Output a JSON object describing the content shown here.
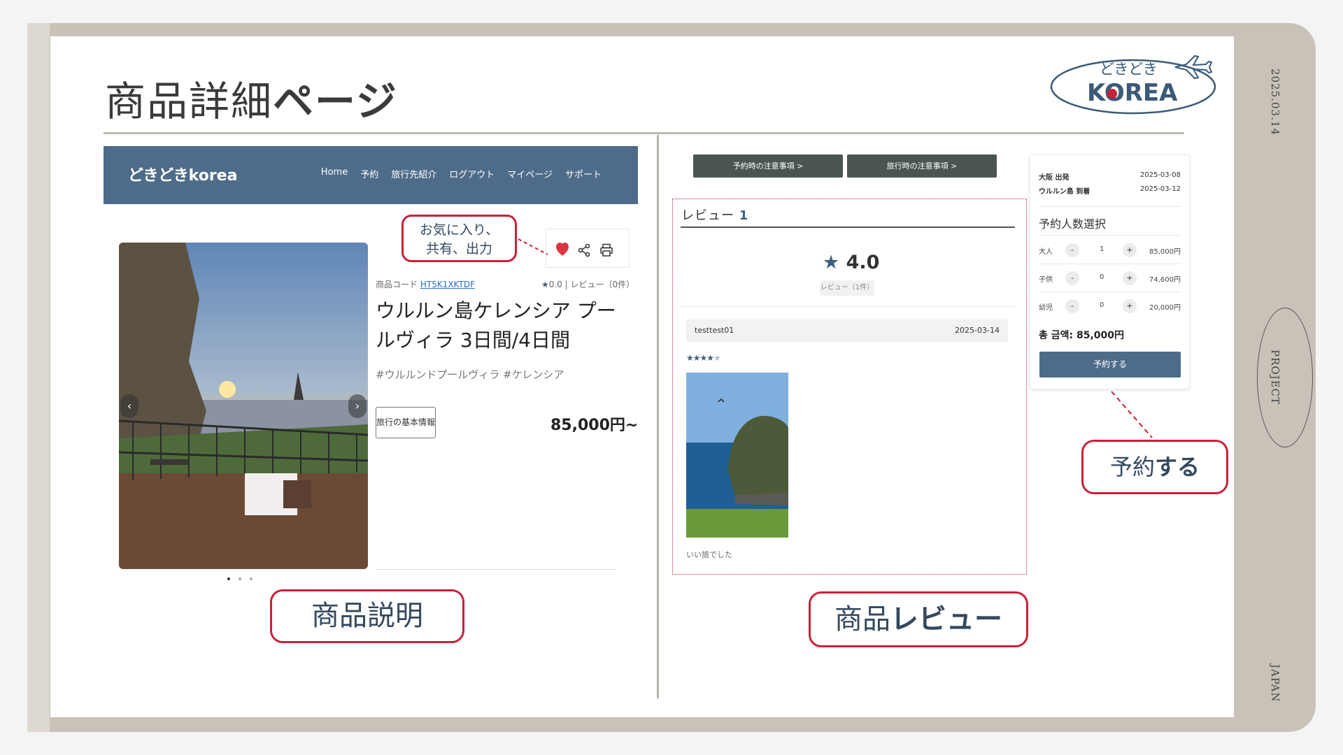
{
  "slide": {
    "title_light": "商品詳細",
    "title_bold": "ページ",
    "date": "2025.03.14",
    "side_project": "PROJECT",
    "side_japan": "JAPAN",
    "logo_top": "どきどき",
    "logo_bottom": "KOREA"
  },
  "site": {
    "brand": "どきどきkorea",
    "nav": [
      "Home",
      "予約",
      "旅行先紹介",
      "ログアウト",
      "マイページ",
      "サポート"
    ]
  },
  "product": {
    "code_label": "商品コード",
    "code": "HT5K1XKTDF",
    "rating_mini": "0.0",
    "review_mini": "レビュー（0件）",
    "name": "ウルルン島ケレンシア プールヴィラ 3日間/4日間",
    "tags": "#ウルルンドプールヴィラ #ケレンシア",
    "info_button": "旅行の基本情報",
    "price": "85,000円~"
  },
  "callouts": {
    "favorite_line1": "お気に入り、",
    "favorite_line2": "共有、出力",
    "product_desc": "商品説明",
    "product_review_light": "商品",
    "product_review_bold": "レビュー",
    "reserve_light": "予約",
    "reserve_bold": "する"
  },
  "notices": [
    "予約時の注意事項 >",
    "旅行時の注意事項 >"
  ],
  "review": {
    "title_label": "レビュー",
    "title_count": "1",
    "avg": "4.0",
    "count_label": "レビュー（1件）",
    "user": "testtest01",
    "date": "2025-03-14",
    "stars_on": "★★★★",
    "stars_off": "★",
    "text": "いい旅でした"
  },
  "booking": {
    "depart_label": "大阪 出発",
    "depart_date": "2025-03-08",
    "arrive_label": "ウルルン島 到着",
    "arrive_date": "2025-03-12",
    "title": "予約人数選択",
    "pax": [
      {
        "label": "大人",
        "qty": "1",
        "amount": "85,000円"
      },
      {
        "label": "子供",
        "qty": "0",
        "amount": "74,600円"
      },
      {
        "label": "幼児",
        "qty": "0",
        "amount": "20,000円"
      }
    ],
    "minus": "-",
    "plus": "+",
    "total": "총 금액: 85,000円",
    "button": "予約する"
  },
  "colors": {
    "navbar": "#4e6c89",
    "accent_red": "#c8213c",
    "frame": "#c8c2b8",
    "notice_button": "#4a5550"
  }
}
